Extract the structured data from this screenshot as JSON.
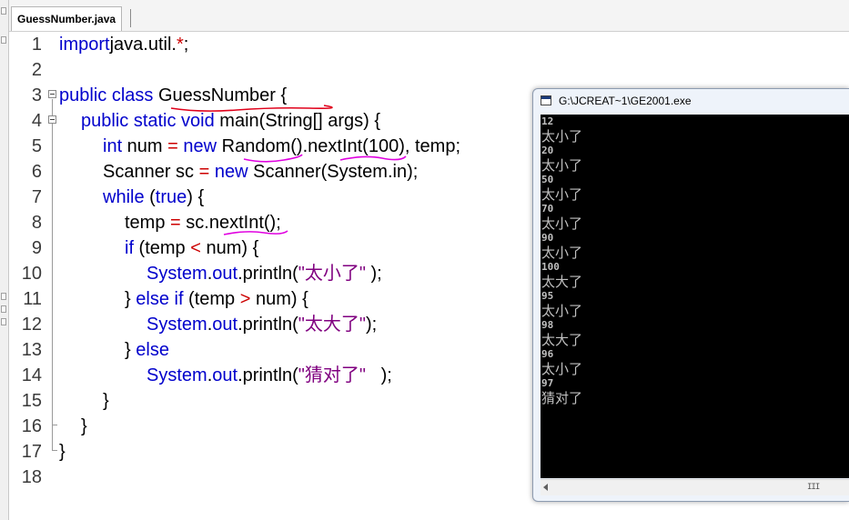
{
  "editor": {
    "tab_label": "GuessNumber.java",
    "line_numbers": [
      "1",
      "2",
      "3",
      "4",
      "5",
      "6",
      "7",
      "8",
      "9",
      "10",
      "11",
      "12",
      "13",
      "14",
      "15",
      "16",
      "17",
      "18"
    ],
    "lines": [
      [
        [
          "k",
          "import"
        ],
        [
          "",
          "java.util."
        ],
        [
          "o",
          "*"
        ],
        [
          "",
          ";"
        ]
      ],
      [],
      [
        [
          "k",
          "public class"
        ],
        [
          "",
          " GuessNumber {"
        ]
      ],
      [
        [
          "",
          ""
        ],
        [
          "k",
          "public static void"
        ],
        [
          "",
          " main(String[] args) {"
        ]
      ],
      [
        [
          "",
          ""
        ],
        [
          "k",
          "int"
        ],
        [
          "",
          " num "
        ],
        [
          "o",
          "="
        ],
        [
          "",
          " "
        ],
        [
          "k",
          "new"
        ],
        [
          "",
          " Random().nextInt(100), temp;"
        ]
      ],
      [
        [
          "",
          "Scanner sc "
        ],
        [
          "o",
          "="
        ],
        [
          "",
          " "
        ],
        [
          "k",
          "new"
        ],
        [
          "",
          " Scanner(System.in);"
        ]
      ],
      [
        [
          "k",
          "while"
        ],
        [
          "",
          " ("
        ],
        [
          "k",
          "true"
        ],
        [
          "",
          ") {"
        ]
      ],
      [
        [
          "",
          "temp "
        ],
        [
          "o",
          "="
        ],
        [
          "",
          " sc.nextInt();"
        ]
      ],
      [
        [
          "k",
          "if"
        ],
        [
          "",
          " (temp "
        ],
        [
          "o",
          "<"
        ],
        [
          "",
          " num) {"
        ]
      ],
      [
        [
          "k",
          "System"
        ],
        [
          "",
          "."
        ],
        [
          "k",
          "out"
        ],
        [
          "",
          ".println("
        ],
        [
          "s",
          "\"太小了\""
        ],
        [
          "",
          " );"
        ]
      ],
      [
        [
          "",
          "} "
        ],
        [
          "k",
          "else if"
        ],
        [
          "",
          " (temp "
        ],
        [
          "o",
          ">"
        ],
        [
          "",
          " num) {"
        ]
      ],
      [
        [
          "k",
          "System"
        ],
        [
          "",
          "."
        ],
        [
          "k",
          "out"
        ],
        [
          "",
          ".println("
        ],
        [
          "s",
          "\"太大了\""
        ],
        [
          "",
          ");"
        ]
      ],
      [
        [
          "",
          "} "
        ],
        [
          "k",
          "else"
        ]
      ],
      [
        [
          "k",
          "System"
        ],
        [
          "",
          "."
        ],
        [
          "k",
          "out"
        ],
        [
          "",
          ".println("
        ],
        [
          "s",
          "\"猜对了\""
        ],
        [
          "",
          "   );"
        ]
      ],
      [
        [
          "",
          "}"
        ]
      ],
      [
        [
          "",
          "}"
        ]
      ],
      [
        [
          "",
          "}"
        ]
      ],
      []
    ]
  },
  "console": {
    "title": "G:\\JCREAT~1\\GE2001.exe",
    "output": [
      {
        "t": "num",
        "v": "12"
      },
      {
        "t": "msg",
        "v": "太小了"
      },
      {
        "t": "num",
        "v": "20"
      },
      {
        "t": "msg",
        "v": "太小了"
      },
      {
        "t": "num",
        "v": "50"
      },
      {
        "t": "msg",
        "v": "太小了"
      },
      {
        "t": "num",
        "v": "70"
      },
      {
        "t": "msg",
        "v": "太小了"
      },
      {
        "t": "num",
        "v": "90"
      },
      {
        "t": "msg",
        "v": "太小了"
      },
      {
        "t": "num",
        "v": "100"
      },
      {
        "t": "msg",
        "v": "太大了"
      },
      {
        "t": "num",
        "v": "95"
      },
      {
        "t": "msg",
        "v": "太小了"
      },
      {
        "t": "num",
        "v": "98"
      },
      {
        "t": "msg",
        "v": "太大了"
      },
      {
        "t": "num",
        "v": "96"
      },
      {
        "t": "msg",
        "v": "太小了"
      },
      {
        "t": "num",
        "v": "97"
      },
      {
        "t": "msg",
        "v": "猜对了"
      }
    ],
    "scroll_grip": "III"
  },
  "colors": {
    "keyword": "#0000cc",
    "string": "#800080",
    "operator": "#cc0000",
    "annotation_red": "#e0001a",
    "annotation_magenta": "#e000e0"
  }
}
